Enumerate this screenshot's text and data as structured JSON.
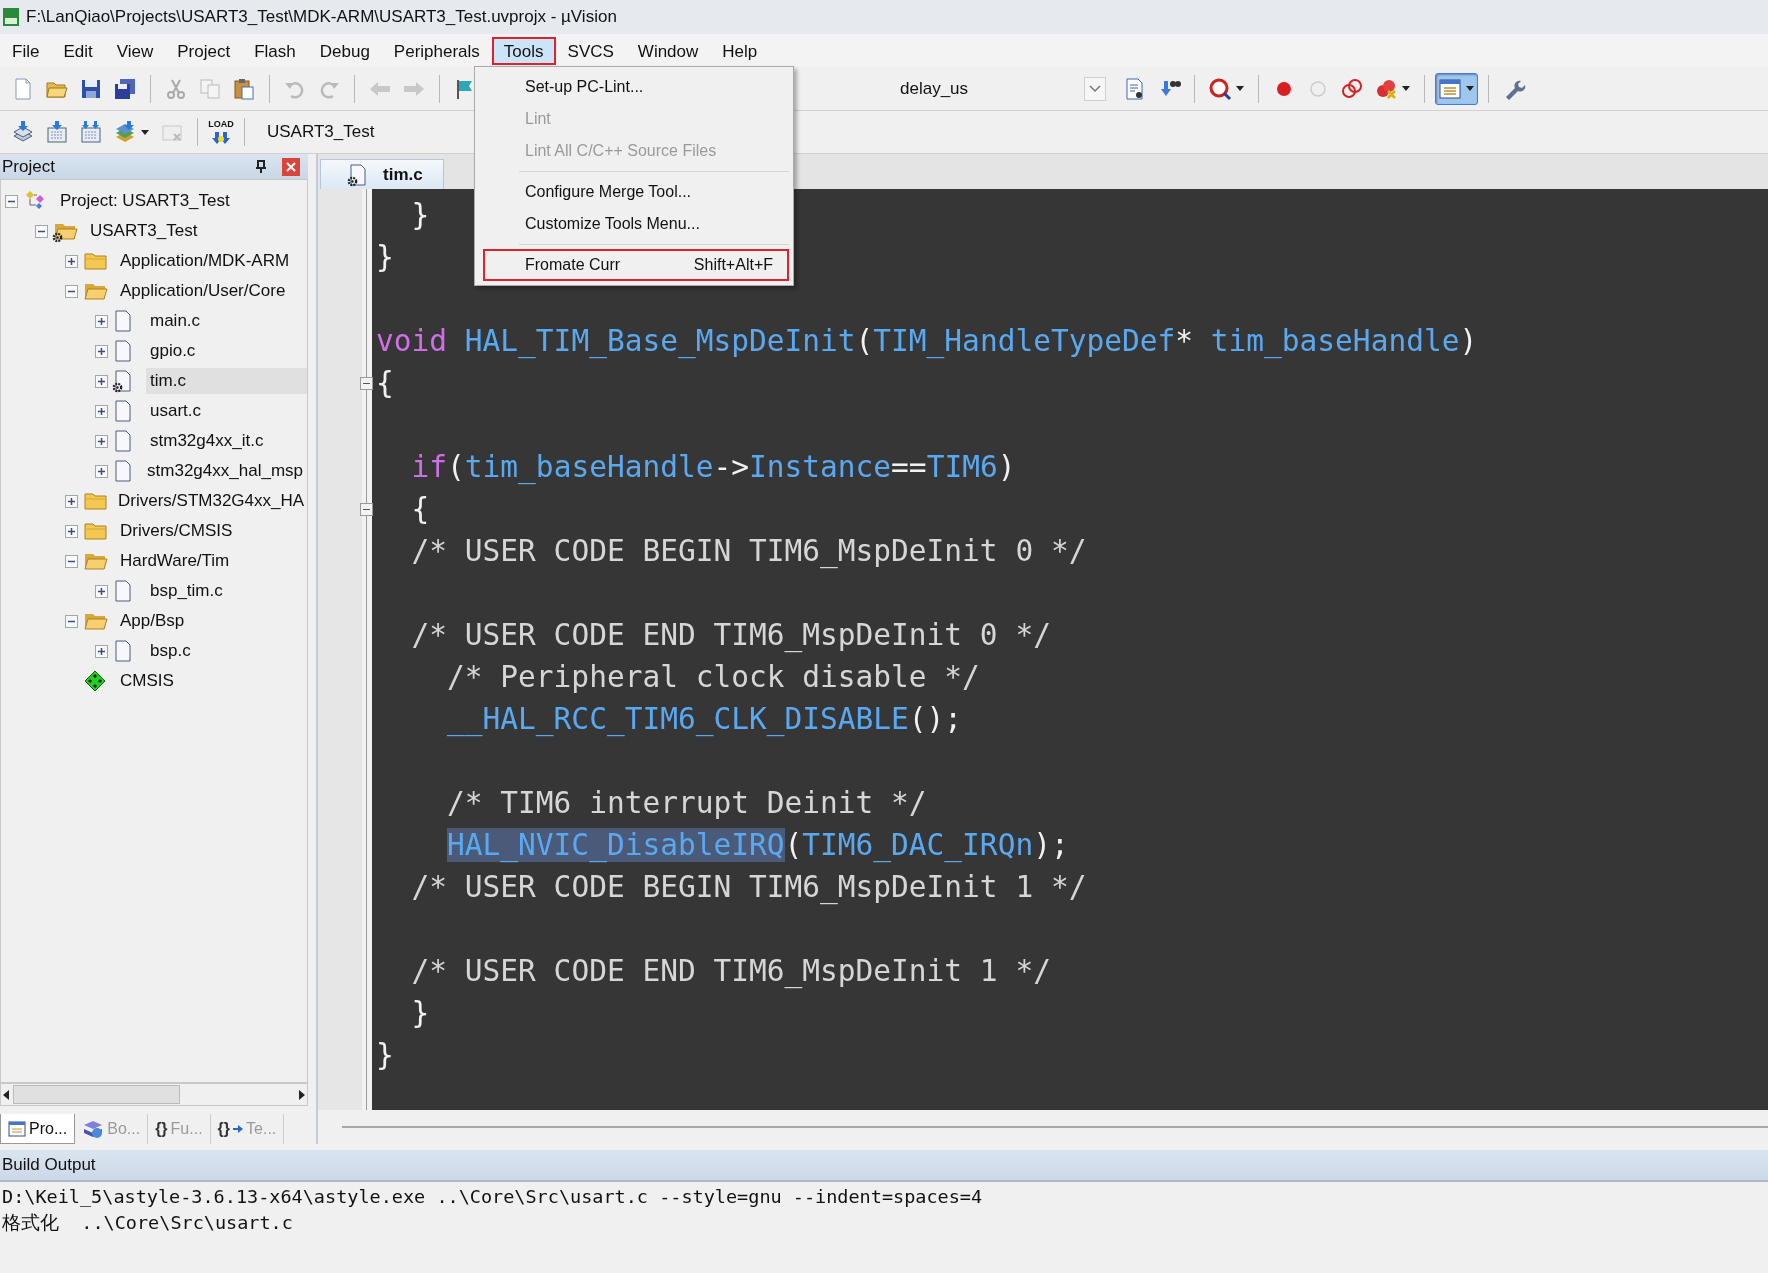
{
  "window": {
    "title": "F:\\LanQiao\\Projects\\USART3_Test\\MDK-ARM\\USART3_Test.uvprojx - µVision"
  },
  "menu_bar": [
    {
      "label": "File",
      "selected": false,
      "highlighted": false
    },
    {
      "label": "Edit",
      "selected": false,
      "highlighted": false
    },
    {
      "label": "View",
      "selected": false,
      "highlighted": false
    },
    {
      "label": "Project",
      "selected": false,
      "highlighted": false
    },
    {
      "label": "Flash",
      "selected": false,
      "highlighted": false
    },
    {
      "label": "Debug",
      "selected": false,
      "highlighted": false
    },
    {
      "label": "Peripherals",
      "selected": false,
      "highlighted": false
    },
    {
      "label": "Tools",
      "selected": true,
      "highlighted": true
    },
    {
      "label": "SVCS",
      "selected": false,
      "highlighted": false
    },
    {
      "label": "Window",
      "selected": false,
      "highlighted": false
    },
    {
      "label": "Help",
      "selected": false,
      "highlighted": false
    }
  ],
  "tools_menu": [
    {
      "kind": "item",
      "label": "Set-up PC-Lint...",
      "disabled": false,
      "highlighted": false
    },
    {
      "kind": "item",
      "label": "Lint",
      "disabled": true,
      "highlighted": false
    },
    {
      "kind": "item",
      "label": "Lint All C/C++ Source Files",
      "disabled": true,
      "highlighted": false
    },
    {
      "kind": "separator"
    },
    {
      "kind": "item",
      "label": "Configure Merge Tool...",
      "disabled": false,
      "highlighted": false
    },
    {
      "kind": "item",
      "label": "Customize Tools Menu...",
      "disabled": false,
      "highlighted": false
    },
    {
      "kind": "separator"
    },
    {
      "kind": "item",
      "label": "Fromate Curr",
      "shortcut": "Shift+Alt+F",
      "disabled": false,
      "highlighted": true
    }
  ],
  "toolbar": {
    "function_combo": {
      "value": "delay_us"
    },
    "view_toggle": {
      "selected": true
    },
    "load_label": "LOAD",
    "target_combo": {
      "value": "USART3_Test"
    }
  },
  "project_panel": {
    "title": "Project",
    "tree": [
      {
        "label": "Project: USART3_Test",
        "kind": "project",
        "expanded": true,
        "selected": false,
        "options": false,
        "children": [
          {
            "label": "USART3_Test",
            "kind": "target",
            "expanded": true,
            "selected": false,
            "options": true,
            "children": [
              {
                "label": "Application/MDK-ARM",
                "kind": "group",
                "expanded": false,
                "selected": false,
                "options": false
              },
              {
                "label": "Application/User/Core",
                "kind": "group",
                "expanded": true,
                "selected": false,
                "options": false,
                "children": [
                  {
                    "label": "main.c",
                    "kind": "file",
                    "expanded": false,
                    "selected": false,
                    "options": false
                  },
                  {
                    "label": "gpio.c",
                    "kind": "file",
                    "expanded": false,
                    "selected": false,
                    "options": false
                  },
                  {
                    "label": "tim.c",
                    "kind": "file",
                    "expanded": false,
                    "selected": true,
                    "options": true
                  },
                  {
                    "label": "usart.c",
                    "kind": "file",
                    "expanded": false,
                    "selected": false,
                    "options": false
                  },
                  {
                    "label": "stm32g4xx_it.c",
                    "kind": "file",
                    "expanded": false,
                    "selected": false,
                    "options": false
                  },
                  {
                    "label": "stm32g4xx_hal_msp",
                    "kind": "file",
                    "expanded": false,
                    "selected": false,
                    "options": false
                  }
                ]
              },
              {
                "label": "Drivers/STM32G4xx_HA",
                "kind": "group",
                "expanded": false,
                "selected": false,
                "options": false
              },
              {
                "label": "Drivers/CMSIS",
                "kind": "group",
                "expanded": false,
                "selected": false,
                "options": false
              },
              {
                "label": "HardWare/Tim",
                "kind": "group",
                "expanded": true,
                "selected": false,
                "options": false,
                "children": [
                  {
                    "label": "bsp_tim.c",
                    "kind": "file",
                    "expanded": false,
                    "selected": false,
                    "options": false
                  }
                ]
              },
              {
                "label": "App/Bsp",
                "kind": "group",
                "expanded": true,
                "selected": false,
                "options": false,
                "children": [
                  {
                    "label": "bsp.c",
                    "kind": "file",
                    "expanded": false,
                    "selected": false,
                    "options": false
                  }
                ]
              },
              {
                "label": "CMSIS",
                "kind": "component",
                "selected": false,
                "options": false
              }
            ]
          }
        ]
      }
    ],
    "tabs": [
      {
        "kind": "project",
        "label": "Pro...",
        "selected": true
      },
      {
        "kind": "books",
        "label": "Bo...",
        "selected": false
      },
      {
        "kind": "functions",
        "glyph": "{}",
        "label": "Fu...",
        "selected": false
      },
      {
        "kind": "templates",
        "glyph": "{}",
        "label": "Te...",
        "selected": false
      }
    ]
  },
  "editor": {
    "tabs": [
      {
        "label": "tim.c",
        "selected": true,
        "options": true
      }
    ],
    "lines": [
      {
        "fold": false,
        "tokens": [
          {
            "kind": "punct",
            "text": "  }"
          }
        ]
      },
      {
        "fold": false,
        "tokens": [
          {
            "kind": "punct",
            "text": "}"
          }
        ]
      },
      {
        "fold": false
      },
      {
        "fold": false,
        "tokens": [
          {
            "kind": "keyword",
            "text": "void"
          },
          {
            "kind": "ident",
            "text": " HAL_TIM_Base_MspDeInit"
          },
          {
            "kind": "punct",
            "text": "("
          },
          {
            "kind": "ident",
            "text": "TIM_HandleTypeDef"
          },
          {
            "kind": "punct",
            "text": "* "
          },
          {
            "kind": "ident",
            "text": "tim_baseHandle"
          },
          {
            "kind": "punct",
            "text": ")"
          }
        ]
      },
      {
        "fold": true,
        "tokens": [
          {
            "kind": "punct",
            "text": "{"
          }
        ]
      },
      {
        "fold": false
      },
      {
        "fold": false,
        "tokens": [
          {
            "kind": "keyword",
            "text": "  if"
          },
          {
            "kind": "punct",
            "text": "("
          },
          {
            "kind": "ident",
            "text": "tim_baseHandle"
          },
          {
            "kind": "punct",
            "text": "->"
          },
          {
            "kind": "ident",
            "text": "Instance"
          },
          {
            "kind": "punct",
            "text": "=="
          },
          {
            "kind": "ident",
            "text": "TIM6"
          },
          {
            "kind": "punct",
            "text": ")"
          }
        ]
      },
      {
        "fold": true,
        "tokens": [
          {
            "kind": "punct",
            "text": "  {"
          }
        ]
      },
      {
        "fold": false,
        "tokens": [
          {
            "kind": "comment",
            "text": "  /* USER CODE BEGIN TIM6_MspDeInit 0 */"
          }
        ]
      },
      {
        "fold": false
      },
      {
        "fold": false,
        "tokens": [
          {
            "kind": "comment",
            "text": "  /* USER CODE END TIM6_MspDeInit 0 */"
          }
        ]
      },
      {
        "fold": false,
        "tokens": [
          {
            "kind": "comment",
            "text": "    /* Peripheral clock disable */"
          }
        ]
      },
      {
        "fold": false,
        "tokens": [
          {
            "kind": "ident",
            "text": "    __HAL_RCC_TIM6_CLK_DISABLE"
          },
          {
            "kind": "punct",
            "text": "();"
          }
        ]
      },
      {
        "fold": false
      },
      {
        "fold": false,
        "tokens": [
          {
            "kind": "comment",
            "text": "    /* TIM6 interrupt Deinit */"
          }
        ]
      },
      {
        "fold": false,
        "tokens": [
          {
            "kind": "ident",
            "text": "    HAL_NVIC_DisableIRQ",
            "highlighted": true
          },
          {
            "kind": "punct",
            "text": "("
          },
          {
            "kind": "ident",
            "text": "TIM6_DAC_IRQn"
          },
          {
            "kind": "punct",
            "text": ");"
          }
        ]
      },
      {
        "fold": false,
        "tokens": [
          {
            "kind": "comment",
            "text": "  /* USER CODE BEGIN TIM6_MspDeInit 1 */"
          }
        ]
      },
      {
        "fold": false
      },
      {
        "fold": false,
        "tokens": [
          {
            "kind": "comment",
            "text": "  /* USER CODE END TIM6_MspDeInit 1 */"
          }
        ]
      },
      {
        "fold": false,
        "tokens": [
          {
            "kind": "punct",
            "text": "  }"
          }
        ]
      },
      {
        "fold": false,
        "tokens": [
          {
            "kind": "punct",
            "text": "}"
          }
        ]
      }
    ]
  },
  "build_output": {
    "title": "Build Output",
    "lines": [
      "D:\\Keil_5\\astyle-3.6.13-x64\\astyle.exe ..\\Core\\Src\\usart.c --style=gnu --indent=spaces=4",
      "格式化  ..\\Core\\Src\\usart.c"
    ]
  }
}
